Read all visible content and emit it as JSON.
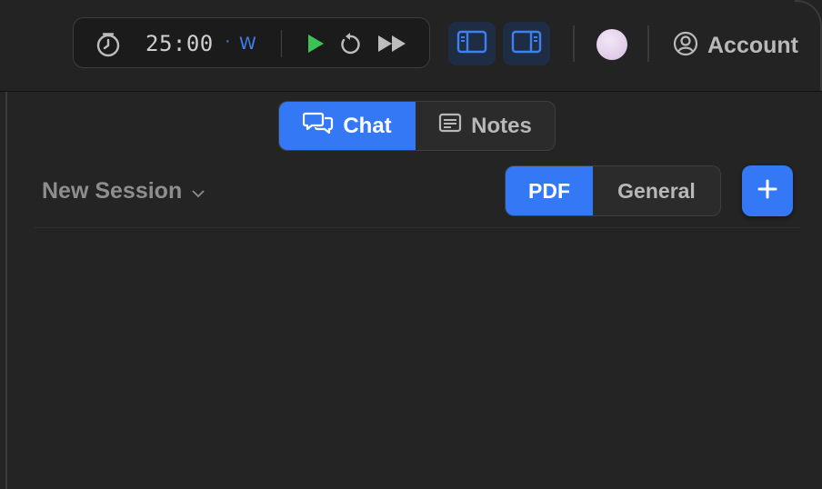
{
  "timer": {
    "time": "25:00",
    "dot": "·",
    "mode": "W",
    "accent": "#3f7ff0"
  },
  "icons": {
    "clock": "timer-icon",
    "play": "play-icon",
    "reset": "reset-icon",
    "skip": "skip-forward-icon",
    "left_panel": "left-sidebar-toggle-icon",
    "right_panel": "right-sidebar-toggle-icon",
    "account": "account-icon",
    "chat": "chat-bubbles-icon",
    "notes": "notes-icon",
    "chevron": "chevron-down-icon",
    "add": "plus-icon"
  },
  "header": {
    "account_label": "Account"
  },
  "tabs": {
    "chat": "Chat",
    "notes": "Notes",
    "active": "Chat"
  },
  "session": {
    "name": "New Session"
  },
  "context": {
    "options": [
      "PDF",
      "General"
    ],
    "selected": "PDF"
  },
  "colors": {
    "accent": "#3478f6",
    "play": "#3cc257",
    "background": "#242424"
  }
}
